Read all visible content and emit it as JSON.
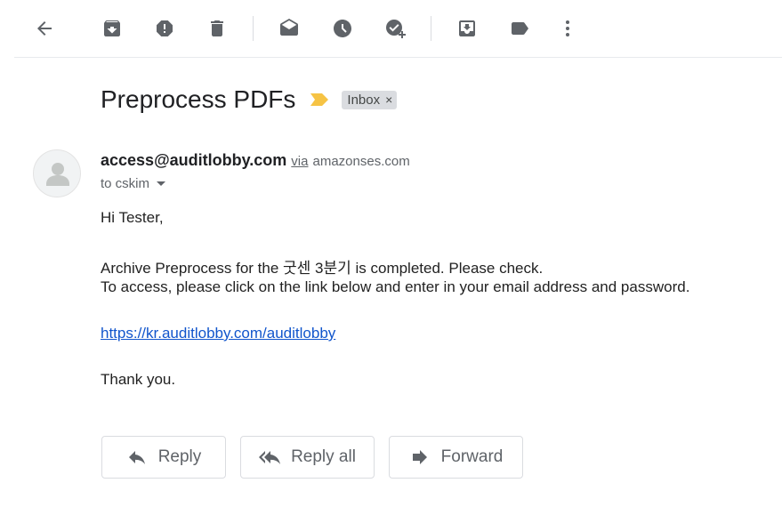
{
  "toolbar": {
    "icons": [
      "back-arrow-icon",
      "archive-icon",
      "report-spam-icon",
      "delete-icon",
      "mark-unread-icon",
      "snooze-icon",
      "add-to-tasks-icon",
      "move-to-icon",
      "labels-icon",
      "more-icon"
    ]
  },
  "message": {
    "subject": "Preprocess PDFs",
    "label_chip": "Inbox",
    "chip_close": "×",
    "sender_email": "access@auditlobby.com",
    "via_label": "via",
    "via_domain": "amazonses.com",
    "recipient": "to cskim",
    "body": {
      "greeting": "Hi Tester,",
      "line1": "Archive Preprocess for the 굿센 3분기 is completed. Please check.",
      "line2": "To access, please click on the link below and enter in your email address and password.",
      "link": "https://kr.auditlobby.com/auditlobby",
      "signoff": "Thank you."
    }
  },
  "actions": {
    "reply": "Reply",
    "reply_all": "Reply all",
    "forward": "Forward"
  },
  "colors": {
    "icon": "#5f6368",
    "importance_marker": "#f6c344",
    "link": "#1155cc",
    "chip_bg": "#dadce0"
  }
}
